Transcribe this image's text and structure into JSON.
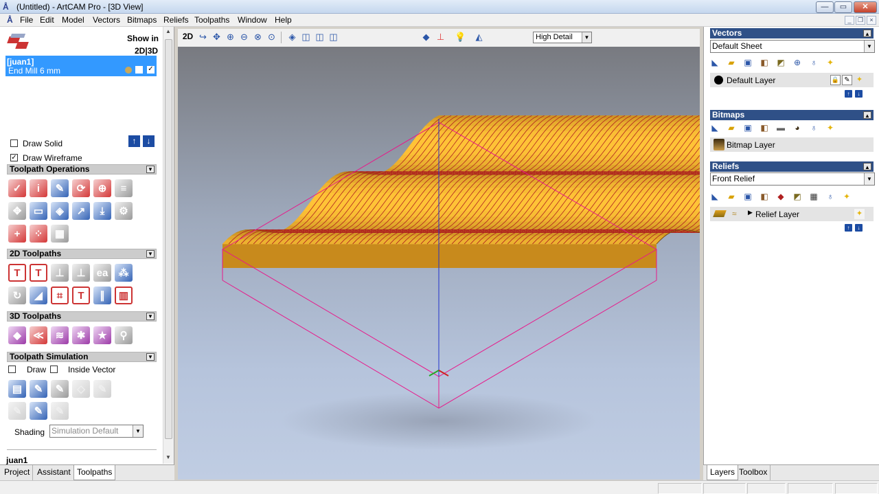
{
  "window": {
    "title": "(Untitled) - ArtCAM Pro - [3D View]",
    "min_glyph": "—",
    "max_glyph": "▭",
    "close_glyph": "✕"
  },
  "menu": [
    "File",
    "Edit",
    "Model",
    "Vectors",
    "Bitmaps",
    "Reliefs",
    "Toolpaths",
    "Window",
    "Help"
  ],
  "left": {
    "show_in_label": "Show in",
    "view_modes": "2D|3D",
    "toolpath": {
      "name": "[juan1]",
      "tool": "End Mill 6 mm"
    },
    "draw_solid": "Draw Solid",
    "draw_wireframe": "Draw Wireframe",
    "sections": {
      "operations": "Toolpath Operations",
      "toolpaths_2d": "2D Toolpaths",
      "toolpaths_3d": "3D Toolpaths",
      "simulation": "Toolpath Simulation"
    },
    "simulation": {
      "draw_label": "Draw",
      "inside_vector_label": "Inside Vector",
      "shading_label": "Shading",
      "shading_value": "Simulation Default"
    },
    "footer_name": "juan1",
    "tabs": [
      "Project",
      "Assistant",
      "Toolpaths"
    ],
    "active_tab": "Toolpaths"
  },
  "viewport": {
    "mode_label": "2D",
    "detail_value": "High Detail"
  },
  "right": {
    "vectors": {
      "header": "Vectors",
      "sheet": "Default Sheet",
      "layer": "Default Layer"
    },
    "bitmaps": {
      "header": "Bitmaps",
      "layer": "Bitmap Layer"
    },
    "reliefs": {
      "header": "Reliefs",
      "relief": "Front Relief",
      "layer": "Relief Layer"
    },
    "tabs": [
      "Layers",
      "Toolbox"
    ],
    "active_tab": "Layers"
  },
  "colors": {
    "relief_gold": "#e0a21e",
    "toolpath_red": "#b02020",
    "bounding_box": "#e8188a",
    "selection_blue": "#3399ff",
    "panel_header": "#2f5087"
  }
}
